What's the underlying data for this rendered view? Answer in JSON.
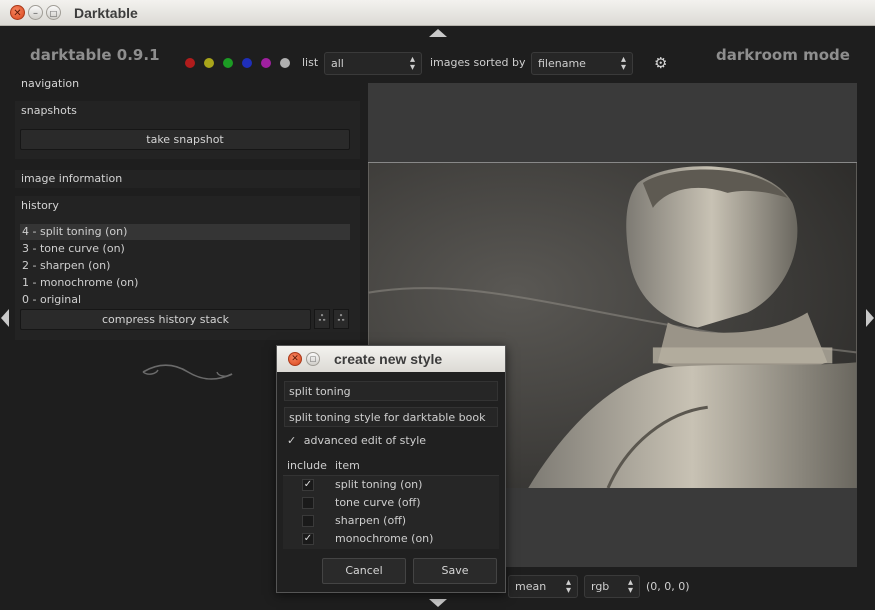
{
  "window": {
    "title": "Darktable"
  },
  "header": {
    "app_name": "darktable 0.9.1",
    "mode": "darkroom mode",
    "color_labels": [
      "#b11c1c",
      "#a9a51a",
      "#1c9c24",
      "#1f2fb9",
      "#a020a0",
      "#b0b0b0"
    ],
    "list_label": "list",
    "list_value": "all",
    "sort_label": "images sorted by",
    "sort_value": "filename"
  },
  "left_panel": {
    "navigation": "navigation",
    "snapshots": "snapshots",
    "take_snapshot": "take snapshot",
    "image_information": "image information",
    "history": "history",
    "history_items": [
      "4 - split toning (on)",
      "3 - tone curve (on)",
      "2 - sharpen (on)",
      "1 - monochrome (on)",
      "0 - original"
    ],
    "compress_button": "compress history stack"
  },
  "bottom_bar": {
    "mode_value": "mean",
    "colorspace_value": "rgb",
    "pixel_value": "(0, 0, 0)"
  },
  "dialog": {
    "title": "create new style",
    "name_value": "split toning",
    "description_value": "split toning style for darktable book",
    "advanced_check": "✓",
    "advanced_label": "advanced edit of style",
    "include_header": "include",
    "item_header": "item",
    "items": [
      {
        "label": "split toning (on)",
        "check": "✓"
      },
      {
        "label": "tone curve (off)",
        "check": ""
      },
      {
        "label": "sharpen (off)",
        "check": ""
      },
      {
        "label": "monochrome (on)",
        "check": "✓"
      }
    ],
    "cancel": "Cancel",
    "save": "Save"
  }
}
